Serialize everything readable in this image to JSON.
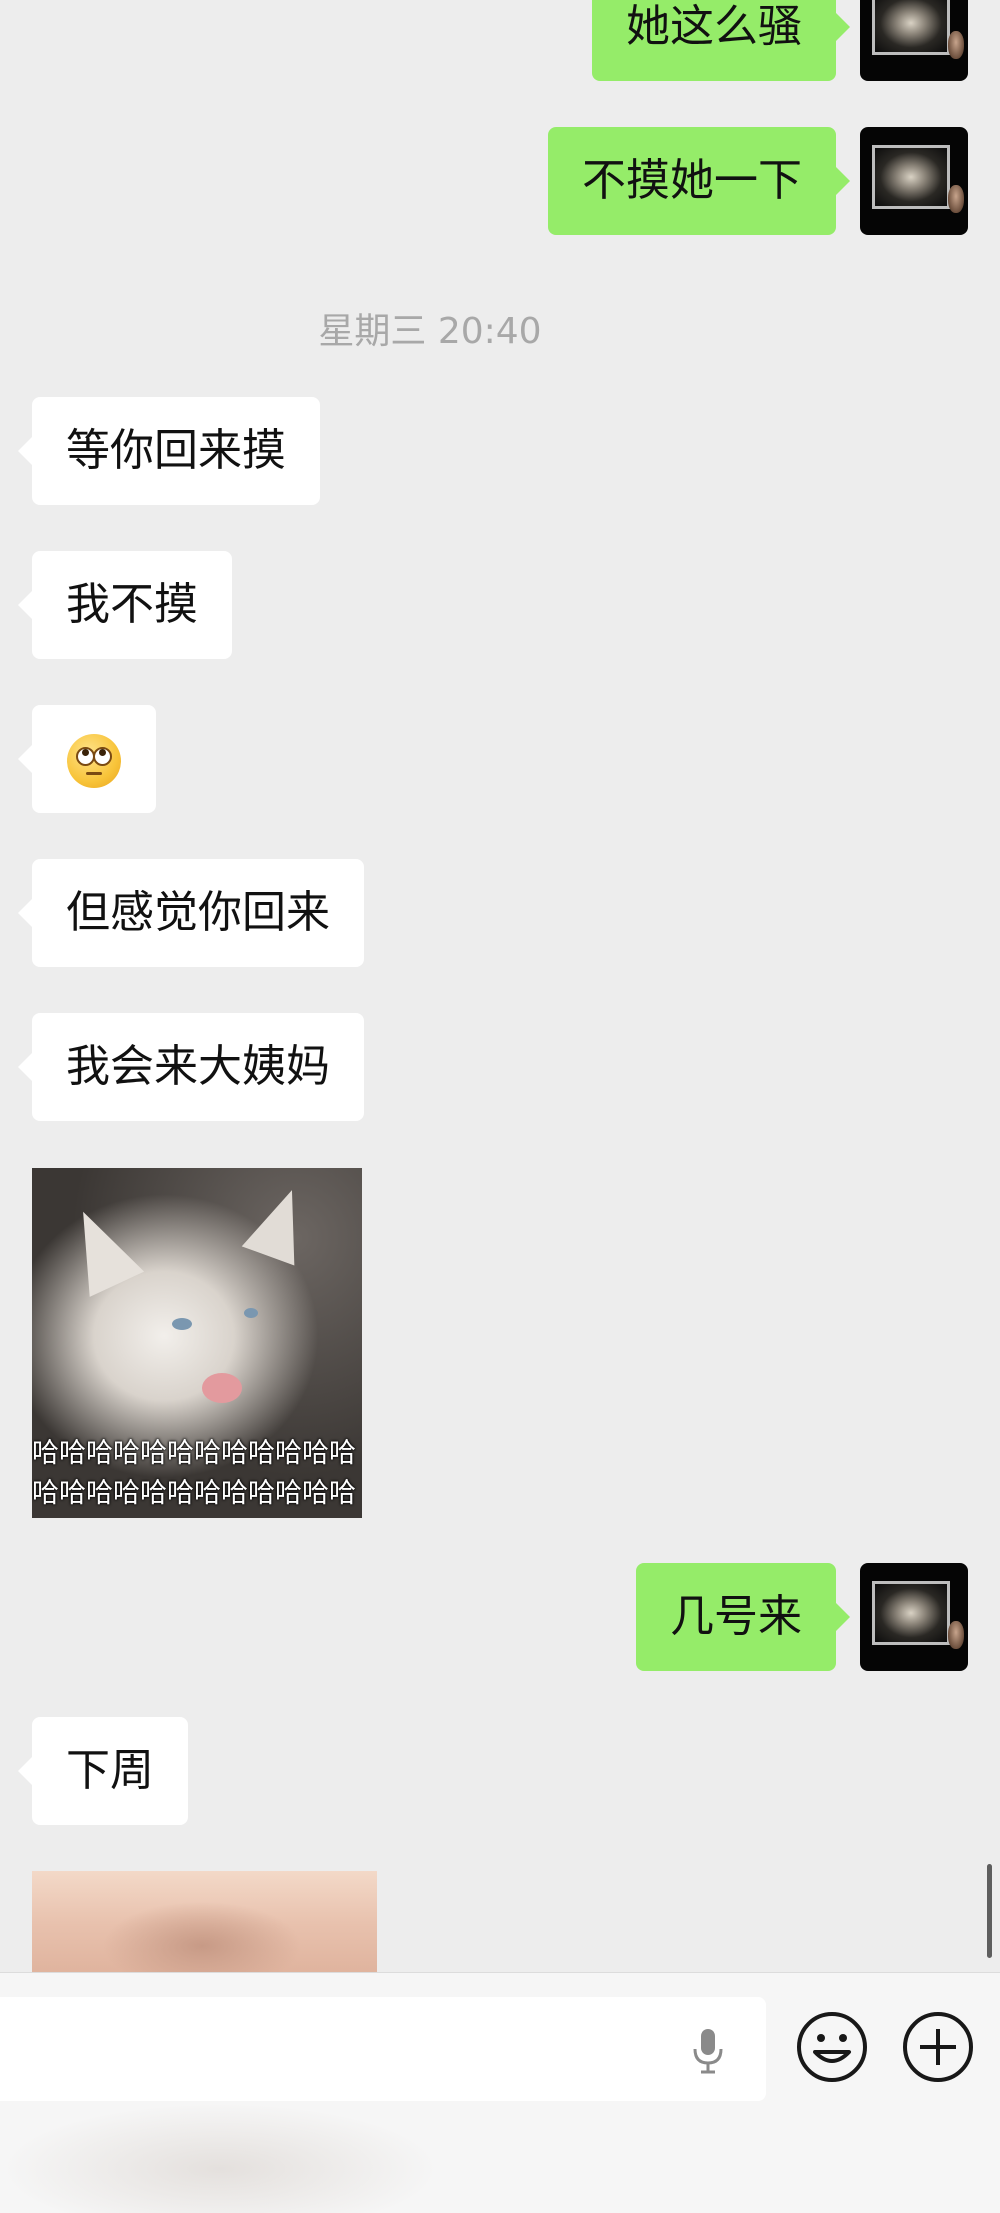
{
  "messages": {
    "m1": {
      "direction": "outgoing",
      "text": "她这么骚"
    },
    "m2": {
      "direction": "outgoing",
      "text": "不摸她一下"
    },
    "timestamp": "星期三 20:40",
    "m3": {
      "direction": "incoming",
      "text": "等你回来摸"
    },
    "m4": {
      "direction": "incoming",
      "text": "我不摸"
    },
    "m5": {
      "direction": "incoming",
      "emoji": "face-with-rolling-eyes"
    },
    "m6": {
      "direction": "incoming",
      "text": "但感觉你回来"
    },
    "m7": {
      "direction": "incoming",
      "text": "我会来大姨妈"
    },
    "m8": {
      "direction": "incoming",
      "sticker_caption_line1": "哈哈哈哈哈哈哈哈哈哈哈哈",
      "sticker_caption_line2": "哈哈哈哈哈哈哈哈哈哈哈哈"
    },
    "m9": {
      "direction": "outgoing",
      "text": "几号来"
    },
    "m10": {
      "direction": "incoming",
      "text": "下周"
    },
    "m11": {
      "direction": "incoming",
      "type": "image"
    }
  },
  "input_bar": {
    "value": "",
    "placeholder": ""
  },
  "icons": {
    "voice": "microphone-icon",
    "emoji": "smiley-icon",
    "more": "plus-icon"
  },
  "colors": {
    "background": "#ededed",
    "outgoing_bubble": "#95ec69",
    "incoming_bubble": "#ffffff",
    "timestamp": "#a8a8a8"
  }
}
